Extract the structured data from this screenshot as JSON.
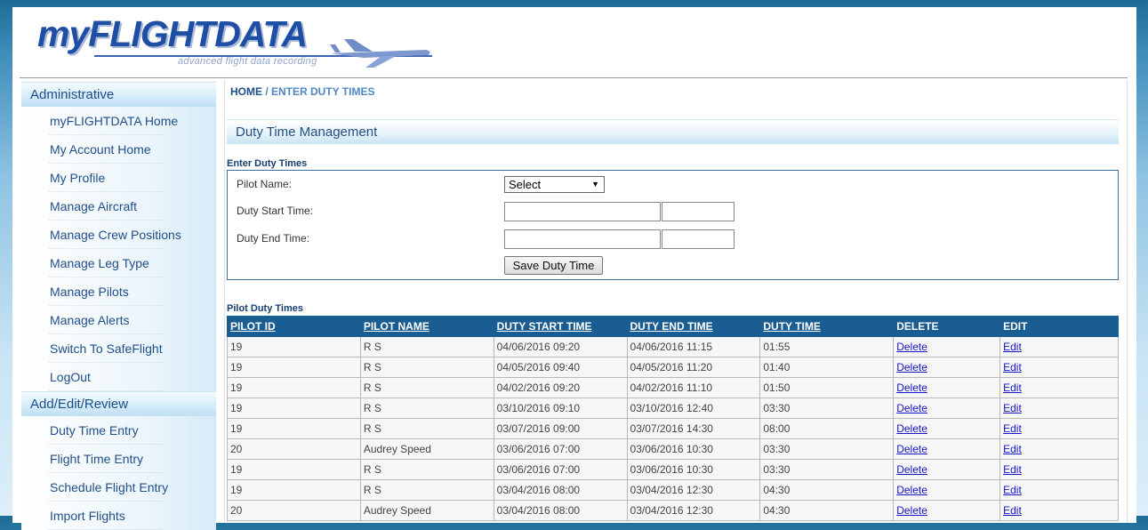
{
  "logo": {
    "brand": "myFLIGHTDATA",
    "tagline": "advanced flight data recording"
  },
  "sidebar": {
    "sections": [
      {
        "title": "Administrative",
        "items": [
          "myFLIGHTDATA Home",
          "My Account Home",
          "My Profile",
          "Manage Aircraft",
          "Manage Crew Positions",
          "Manage Leg Type",
          "Manage Pilots",
          "Manage Alerts",
          "Switch To SafeFlight",
          "LogOut"
        ]
      },
      {
        "title": "Add/Edit/Review",
        "items": [
          "Duty Time Entry",
          "Flight Time Entry",
          "Schedule Flight Entry",
          "Import Flights"
        ]
      }
    ]
  },
  "breadcrumb": {
    "home": "HOME",
    "separator": " / ",
    "current": "ENTER DUTY TIMES"
  },
  "page_title": "Duty Time Management",
  "form": {
    "section_label": "Enter Duty Times",
    "pilot_name_label": "Pilot Name:",
    "pilot_select_value": "Select",
    "start_label": "Duty Start Time:",
    "end_label": "Duty End Time:",
    "start_date_value": "",
    "start_time_value": "",
    "end_date_value": "",
    "end_time_value": "",
    "save_button": "Save Duty Time"
  },
  "table": {
    "label": "Pilot Duty Times",
    "headers": [
      "PILOT ID",
      "PILOT NAME",
      "DUTY START TIME",
      "DUTY END TIME",
      "DUTY TIME",
      "DELETE",
      "EDIT"
    ],
    "rows": [
      [
        "19",
        "R S",
        "04/06/2016 09:20",
        "04/06/2016 11:15",
        "01:55",
        "Delete",
        "Edit"
      ],
      [
        "19",
        "R S",
        "04/05/2016 09:40",
        "04/05/2016 11:20",
        "01:40",
        "Delete",
        "Edit"
      ],
      [
        "19",
        "R S",
        "04/02/2016 09:20",
        "04/02/2016 11:10",
        "01:50",
        "Delete",
        "Edit"
      ],
      [
        "19",
        "R S",
        "03/10/2016 09:10",
        "03/10/2016 12:40",
        "03:30",
        "Delete",
        "Edit"
      ],
      [
        "19",
        "R S",
        "03/07/2016 09:00",
        "03/07/2016 14:30",
        "08:00",
        "Delete",
        "Edit"
      ],
      [
        "20",
        "Audrey Speed",
        "03/06/2016 07:00",
        "03/06/2016 10:30",
        "03:30",
        "Delete",
        "Edit"
      ],
      [
        "19",
        "R S",
        "03/06/2016 07:00",
        "03/06/2016 10:30",
        "03:30",
        "Delete",
        "Edit"
      ],
      [
        "19",
        "R S",
        "03/04/2016 08:00",
        "03/04/2016 12:30",
        "04:30",
        "Delete",
        "Edit"
      ],
      [
        "20",
        "Audrey Speed",
        "03/04/2016 08:00",
        "03/04/2016 12:30",
        "04:30",
        "Delete",
        "Edit"
      ]
    ]
  },
  "colors": {
    "header_bg": "#1a5d93",
    "link": "#1616c8",
    "nav_text": "#204f8a"
  }
}
